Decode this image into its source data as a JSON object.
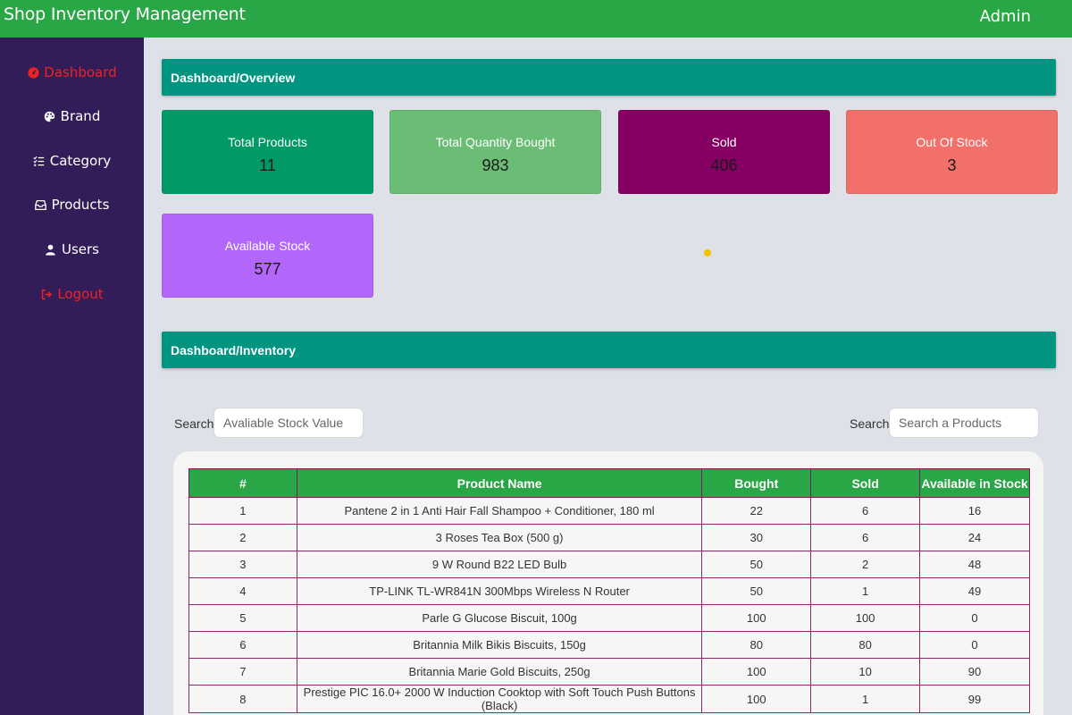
{
  "app": {
    "title": "Shop Inventory Management",
    "user": "Admin"
  },
  "sidebar": {
    "items": [
      {
        "label": "Dashboard",
        "icon": "tachometer-icon",
        "active": true
      },
      {
        "label": "Brand",
        "icon": "palette-icon"
      },
      {
        "label": "Category",
        "icon": "list-check-icon"
      },
      {
        "label": "Products",
        "icon": "inbox-icon"
      },
      {
        "label": "Users",
        "icon": "user-icon"
      },
      {
        "label": "Logout",
        "icon": "sign-out-icon"
      }
    ]
  },
  "overview": {
    "header": "Dashboard/Overview",
    "cards": [
      {
        "label": "Total Products",
        "value": "11",
        "color": "#019966"
      },
      {
        "label": "Total Quantity Bought",
        "value": "983",
        "color": "#6bbd76"
      },
      {
        "label": "Sold",
        "value": "406",
        "color": "#850062"
      },
      {
        "label": "Out Of Stock",
        "value": "3",
        "color": "#f2706a"
      },
      {
        "label": "Available Stock",
        "value": "577",
        "color": "#b366fa"
      }
    ]
  },
  "inventory": {
    "header": "Dashboard/Inventory",
    "search_left": {
      "label": "Search",
      "placeholder": "Avaliable Stock Value"
    },
    "search_right": {
      "label": "Search",
      "placeholder": "Search a Products"
    },
    "columns": [
      "#",
      "Product Name",
      "Bought",
      "Sold",
      "Available in Stock"
    ],
    "rows": [
      [
        "1",
        "Pantene 2 in 1 Anti Hair Fall Shampoo + Conditioner, 180 ml",
        "22",
        "6",
        "16"
      ],
      [
        "2",
        "3 Roses Tea Box (500 g)",
        "30",
        "6",
        "24"
      ],
      [
        "3",
        "9 W Round B22 LED Bulb",
        "50",
        "2",
        "48"
      ],
      [
        "4",
        "TP-LINK TL-WR841N 300Mbps Wireless N Router",
        "50",
        "1",
        "49"
      ],
      [
        "5",
        "Parle G Glucose Biscuit, 100g",
        "100",
        "100",
        "0"
      ],
      [
        "6",
        "Britannia Milk Bikis Biscuits, 150g",
        "80",
        "80",
        "0"
      ],
      [
        "7",
        "Britannia Marie Gold Biscuits, 250g",
        "100",
        "10",
        "90"
      ],
      [
        "8",
        "Prestige PIC 16.0+ 2000 W Induction Cooktop with Soft Touch Push Buttons (Black)",
        "100",
        "1",
        "99"
      ]
    ]
  },
  "colors": {
    "topbar": "#29a645",
    "sidebar": "#331d58",
    "section": "#019581",
    "active_nav": "#ee2222"
  }
}
